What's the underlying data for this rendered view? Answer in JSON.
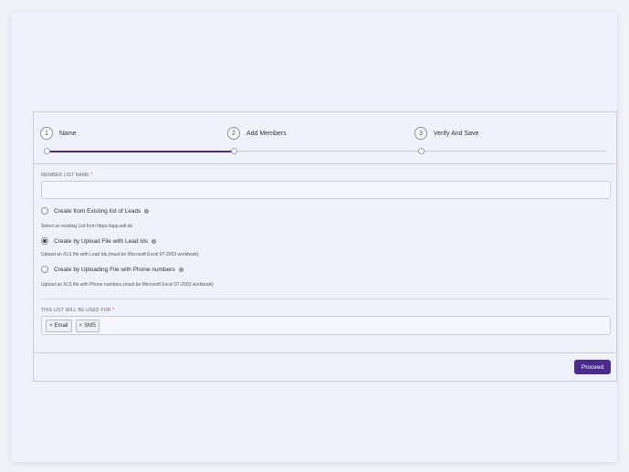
{
  "steps": [
    {
      "num": "1",
      "label": "Name"
    },
    {
      "num": "2",
      "label": "Add Members"
    },
    {
      "num": "3",
      "label": "Verify And Save"
    }
  ],
  "progress_percent": 33,
  "form": {
    "list_name_label": "MEMBER LIST NAME",
    "required_mark": "*",
    "list_name_value": "",
    "options": [
      {
        "label": "Create from Existing list of Leads",
        "hint": "Select an existing List from https://app.sell.do",
        "checked": false
      },
      {
        "label": "Create by Upload File with Lead Ids",
        "hint": "Upload an XLS file with Lead Ids.(must be Microsoft Excel 97-2003 workbook)",
        "checked": true
      },
      {
        "label": "Create by Uploading File with Phone numbers",
        "hint": "Upload an XLS file with Phone numbers.(must be Microsoft Excel 97-2003 workbook)",
        "checked": false
      }
    ],
    "used_for_label": "THIS LIST WILL BE USED FOR",
    "tags": [
      "Email",
      "SMS"
    ],
    "tag_remove": "×",
    "info_glyph": "i"
  },
  "footer": {
    "proceed_label": "Proceed"
  },
  "colors": {
    "accent": "#4b2a8e",
    "required": "#d23030"
  }
}
